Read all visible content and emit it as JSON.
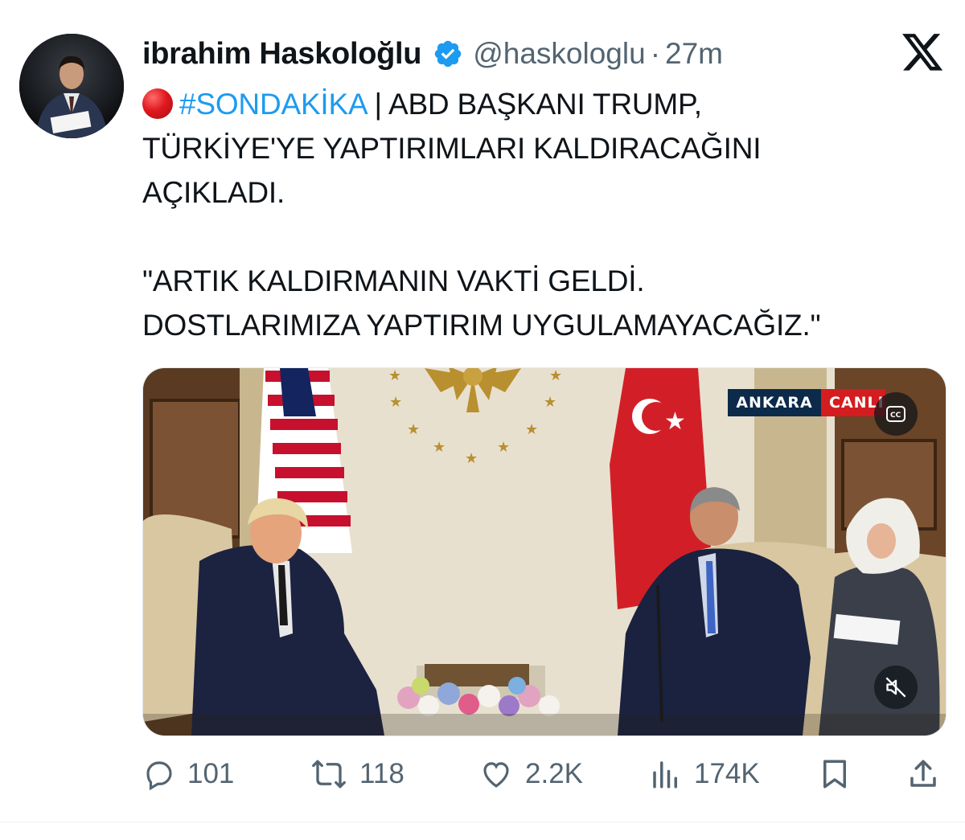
{
  "tweet": {
    "author": {
      "display_name": "ibrahim Haskoloğlu",
      "handle": "@haskologlu",
      "separator": "·",
      "time_ago": "27m",
      "verified": true
    },
    "text": {
      "hashtag": "#SONDAKİKA",
      "line1_rest": " | ABD BAŞKANI TRUMP,",
      "line2": "TÜRKİYE'YE YAPTIRIMLARI KALDIRACAĞINI",
      "line3": "AÇIKLADI.",
      "line4": "\"ARTIK KALDIRMANIN VAKTİ GELDİ.",
      "line5": "DOSTLARIMIZA YAPTIRIM UYGULAMAYACAĞIZ.\""
    },
    "media": {
      "overlay_location": "ANKARA",
      "overlay_live": "CANLI",
      "buttons": [
        "cc-icon",
        "mute-icon"
      ]
    },
    "actions": {
      "replies": "101",
      "reposts": "118",
      "likes": "2.2K",
      "views": "174K"
    }
  },
  "colors": {
    "accent": "#1d9bf0",
    "muted_text": "#536471",
    "breaking_red": "#e0191f",
    "live_red": "#d31d20",
    "location_navy": "#0c2a4a"
  },
  "icons": [
    "x-logo-icon",
    "verified-badge-icon",
    "red-circle-icon",
    "reply-icon",
    "repost-icon",
    "like-icon",
    "views-icon",
    "bookmark-icon",
    "share-icon"
  ]
}
